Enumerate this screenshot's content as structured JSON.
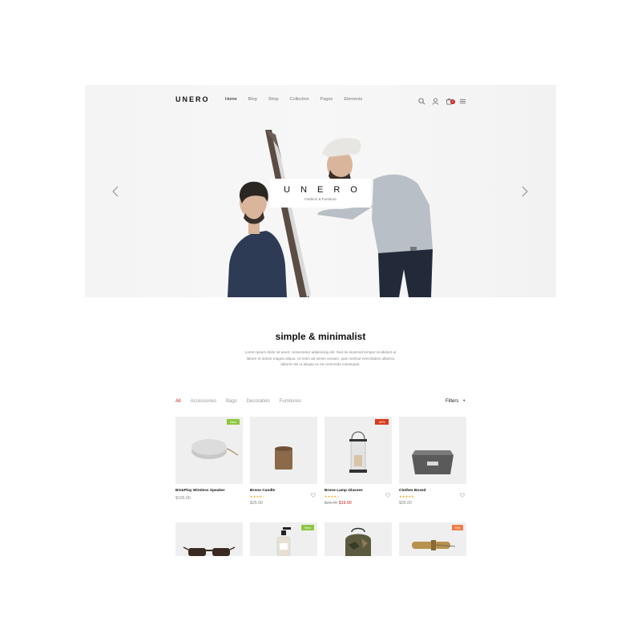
{
  "header": {
    "logo": "UNERO",
    "menu": [
      "Home",
      "Blog",
      "Shop",
      "Collection",
      "Pages",
      "Elements"
    ],
    "icons": [
      "search-icon",
      "user-icon",
      "cart-icon",
      "hamburger-menu-icon"
    ],
    "cart_count": "0"
  },
  "hero": {
    "title": "UNERO",
    "subtitle": "Fashion & Furniture"
  },
  "intro": {
    "title": "simple & minimalist",
    "text": "Lorem ipsum dolor sit amet, consectetur adipisicing elit. Sed do eiusmod tempor incididunt ut labore et dolore magna aliqua. Ut enim ad minim veniam, quis nostrud exercitation ullamco laboris nisi ut aliquip ex ea commodo consequat."
  },
  "filters": {
    "categories": [
      "All",
      "Accessories",
      "Bags",
      "Decoration",
      "Furnitures"
    ],
    "active": "All",
    "button_label": "Filters"
  },
  "products": [
    {
      "name": "BO&Play Wireless Speaker",
      "price": "$105.00",
      "badge": "New",
      "rating": "",
      "old_price": ""
    },
    {
      "name": "Brone Candle",
      "price": "$25.00",
      "badge": "",
      "rating": "4 of 5",
      "old_price": ""
    },
    {
      "name": "Brone Lamp Glasses",
      "price": "$19.00",
      "old_price": "$21.40",
      "badge": "-45%",
      "rating": "4 of 5"
    },
    {
      "name": "Clothes Boxed",
      "price": "$35.00",
      "badge": "",
      "rating": "5 of 5",
      "old_price": ""
    },
    {
      "name": "",
      "price": "",
      "badge": ""
    },
    {
      "name": "",
      "price": "",
      "badge": "New"
    },
    {
      "name": "",
      "price": "",
      "badge": ""
    },
    {
      "name": "",
      "price": "",
      "badge": "Hot"
    }
  ],
  "colors": {
    "accent": "#d21d1d",
    "badge_new": "#8cc63f",
    "badge_sale": "#d9391c",
    "badge_hot": "#f07d47",
    "star": "#f5a623"
  }
}
